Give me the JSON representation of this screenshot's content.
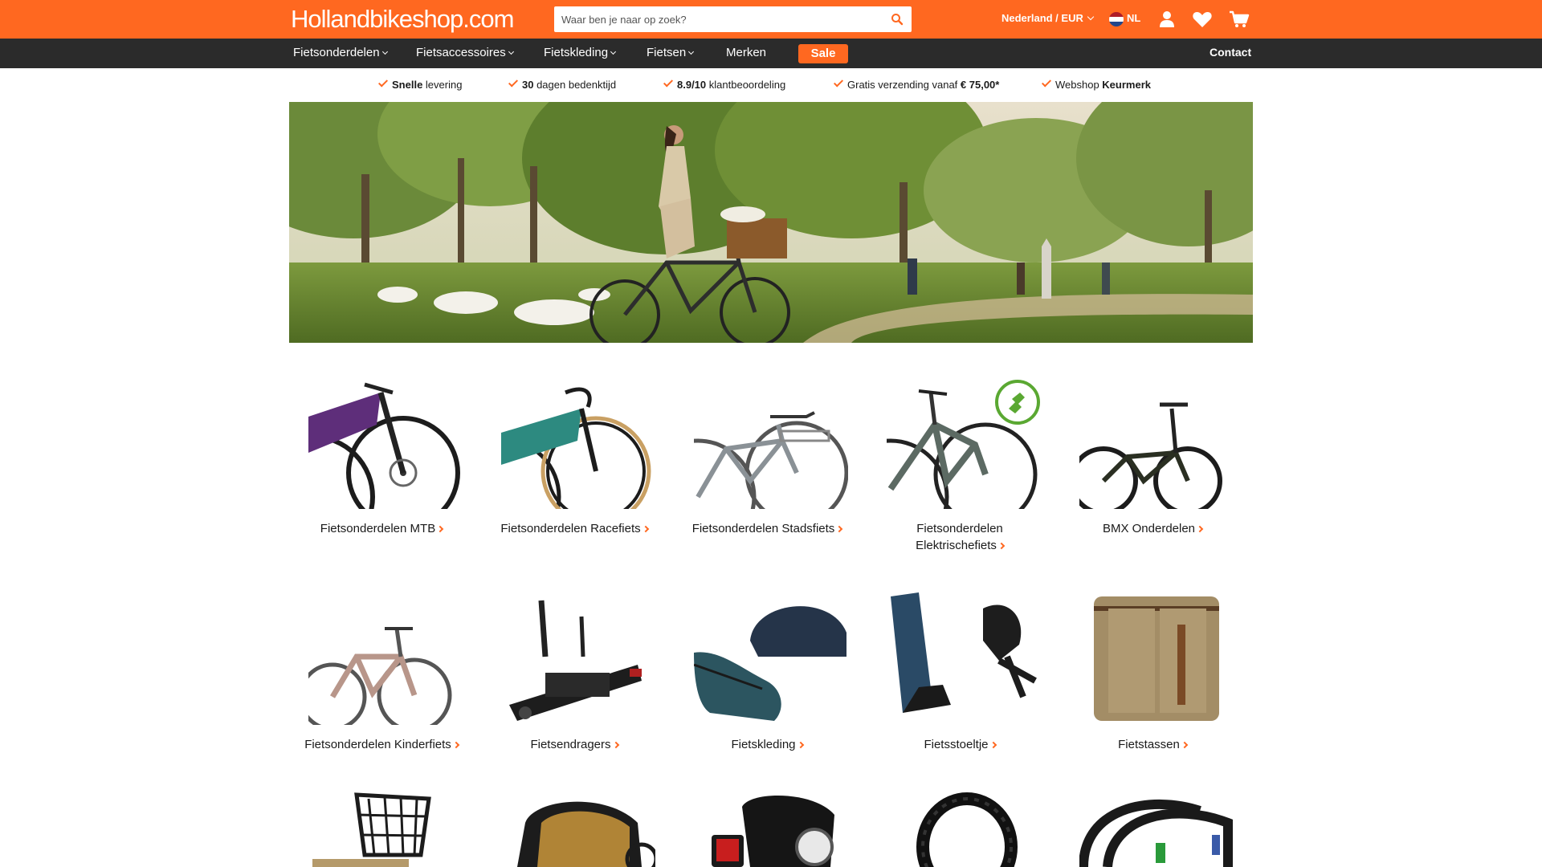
{
  "header": {
    "logo": "Hollandbikeshop.com",
    "search": {
      "placeholder": "Waar ben je naar op zoek?"
    },
    "locale": "Nederland / EUR",
    "lang": "NL",
    "colors": {
      "brand": "#ff6820",
      "nav": "#2b2b2b"
    }
  },
  "nav": {
    "items": [
      {
        "label": "Fietsonderdelen"
      },
      {
        "label": "Fietsaccessoires"
      },
      {
        "label": "Fietskleding"
      },
      {
        "label": "Fietsen"
      },
      {
        "label": "Merken"
      }
    ],
    "sale": "Sale",
    "contact": "Contact"
  },
  "usps": [
    {
      "bold": "Snelle",
      "text": " levering"
    },
    {
      "bold": "30",
      "text": " dagen bedenktijd"
    },
    {
      "bold": "8.9/10",
      "text": " klantbeoordeling"
    },
    {
      "bold": "",
      "text": "Gratis verzending vanaf ",
      "bold2": "€ 75,00*"
    },
    {
      "bold": "",
      "text": "Webshop ",
      "bold2": "Keurmerk"
    }
  ],
  "categories": [
    {
      "label": "Fietsonderdelen MTB",
      "icon": "mtb-bike"
    },
    {
      "label": "Fietsonderdelen Racefiets",
      "icon": "racing-bike"
    },
    {
      "label": "Fietsonderdelen Stadsfiets",
      "icon": "city-bike"
    },
    {
      "label_line1": "Fietsonderdelen",
      "label_line2": "Elektrischefiets",
      "icon": "e-bike"
    },
    {
      "label": "BMX Onderdelen",
      "icon": "bmx-bike"
    },
    {
      "label": "Fietsonderdelen Kinderfiets",
      "icon": "kids-bike"
    },
    {
      "label": "Fietsendragers",
      "icon": "bike-carrier"
    },
    {
      "label": "Fietskleding",
      "icon": "helmet-shoe"
    },
    {
      "label": "Fietsstoeltje",
      "icon": "child-seat"
    },
    {
      "label": "Fietstassen",
      "icon": "pannier-bag"
    },
    {
      "icon": "bike-basket"
    },
    {
      "icon": "bike-trailer"
    },
    {
      "icon": "bike-lights"
    },
    {
      "icon": "chain-lock"
    },
    {
      "icon": "tires"
    }
  ]
}
